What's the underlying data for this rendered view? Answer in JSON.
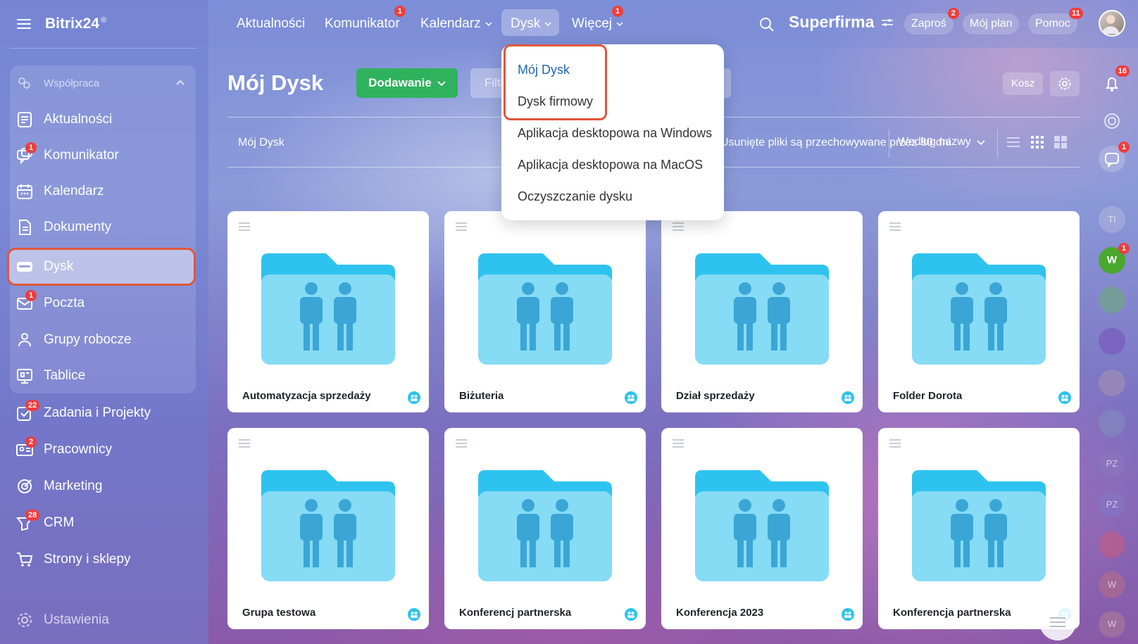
{
  "app": {
    "logo": "Bitrix24",
    "logo_mark": "®"
  },
  "sidebar": {
    "group_label": "Współpraca",
    "items": [
      {
        "label": "Aktualności",
        "badge": "",
        "icon": "news-icon"
      },
      {
        "label": "Komunikator",
        "badge": "1",
        "icon": "chat-icon"
      },
      {
        "label": "Kalendarz",
        "badge": "",
        "icon": "calendar-icon"
      },
      {
        "label": "Dokumenty",
        "badge": "",
        "icon": "document-icon"
      },
      {
        "label": "Dysk",
        "badge": "",
        "icon": "drive-icon"
      },
      {
        "label": "Poczta",
        "badge": "1",
        "icon": "mail-icon"
      },
      {
        "label": "Grupy robocze",
        "badge": "",
        "icon": "groups-icon"
      },
      {
        "label": "Tablice",
        "badge": "",
        "icon": "board-icon"
      },
      {
        "label": "Zadania i Projekty",
        "badge": "22",
        "icon": "tasks-icon"
      },
      {
        "label": "Pracownicy",
        "badge": "2",
        "icon": "employees-icon"
      },
      {
        "label": "Marketing",
        "badge": "",
        "icon": "marketing-icon"
      },
      {
        "label": "CRM",
        "badge": "28",
        "icon": "crm-icon"
      },
      {
        "label": "Strony i sklepy",
        "badge": "",
        "icon": "cart-icon"
      },
      {
        "label": "Ustawienia",
        "badge": "",
        "icon": "gear-icon"
      }
    ]
  },
  "topnav": {
    "items": [
      {
        "label": "Aktualności",
        "badge": ""
      },
      {
        "label": "Komunikator",
        "badge": "1"
      },
      {
        "label": "Kalendarz",
        "badge": ""
      },
      {
        "label": "Dysk",
        "badge": ""
      },
      {
        "label": "Więcej",
        "badge": "1"
      }
    ],
    "company": "Superfirma",
    "invite": {
      "label": "Zaproś",
      "badge": "2"
    },
    "plan": {
      "label": "Mój plan"
    },
    "help": {
      "label": "Pomoc",
      "badge": "11"
    }
  },
  "main": {
    "title": "Mój Dysk",
    "add_button": "Dodawanie",
    "filter_placeholder": "Filtr i wyszukiwanie",
    "trash": "Kosz",
    "breadcrumb": "Mój Dysk",
    "retention_note": "Usunięte pliki są przechowywane przez 30 dni",
    "sort": "Według nazwy"
  },
  "dropdown": {
    "items": [
      {
        "label": "Mój Dysk"
      },
      {
        "label": "Dysk firmowy"
      },
      {
        "label": "Aplikacja desktopowa na Windows"
      },
      {
        "label": "Aplikacja desktopowa na MacOS"
      },
      {
        "label": "Oczyszczanie dysku"
      }
    ]
  },
  "rail": {
    "notifications_badge": "16",
    "chat_badge": "1",
    "avatar_w_badge": "1",
    "initials": [
      "TI",
      "W",
      "PZ",
      "PZ",
      "W",
      "W"
    ]
  },
  "folders": [
    {
      "name": "Automatyzacja sprzedaży"
    },
    {
      "name": "Biżuteria"
    },
    {
      "name": "Dział sprzedaży"
    },
    {
      "name": "Folder Dorota"
    },
    {
      "name": "Grupa testowa"
    },
    {
      "name": "Konferencj partnerska"
    },
    {
      "name": "Konferencja 2023"
    },
    {
      "name": "Konferencja partnerska"
    }
  ],
  "colors": {
    "accent_green": "#2fb25e",
    "badge_red": "#ef3d3d",
    "highlight": "#e2553a",
    "folder_light": "#86dbf5",
    "folder_dark": "#2ec3ef",
    "folder_people": "#3ba6d6"
  }
}
